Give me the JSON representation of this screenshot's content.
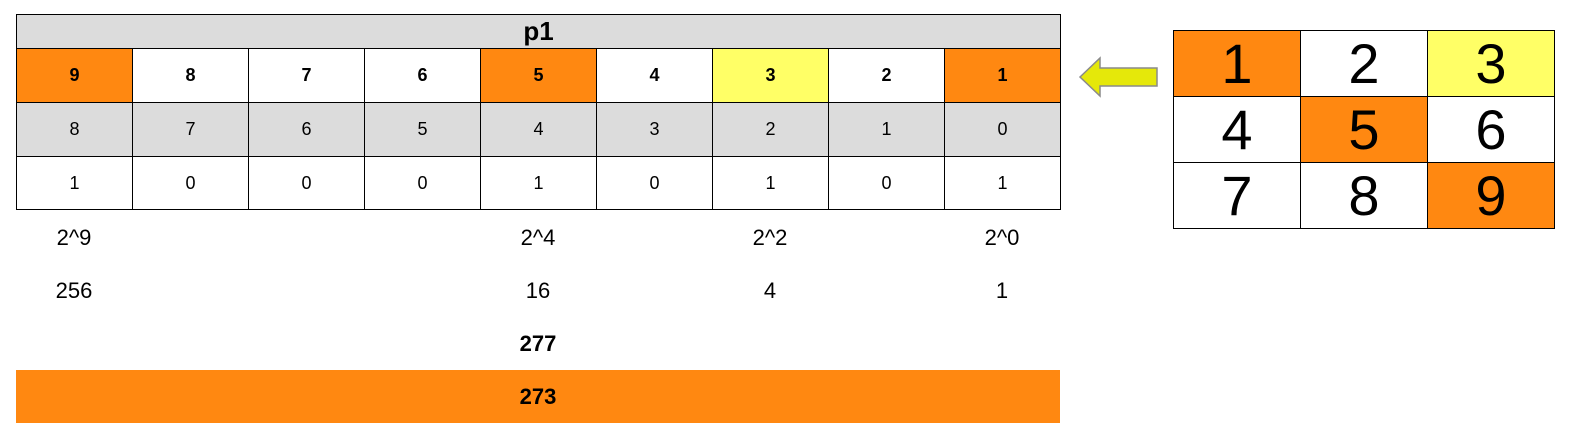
{
  "colors": {
    "orange": "#ff8811",
    "yellow": "#ffff66",
    "gray": "#dcdcdc",
    "white": "#ffffff",
    "arrow": "#e5e80a"
  },
  "table": {
    "title": "p1",
    "columns": [
      {
        "position": "9",
        "index": "8",
        "bit": "1",
        "highlight": "orange"
      },
      {
        "position": "8",
        "index": "7",
        "bit": "0",
        "highlight": "white"
      },
      {
        "position": "7",
        "index": "6",
        "bit": "0",
        "highlight": "white"
      },
      {
        "position": "6",
        "index": "5",
        "bit": "0",
        "highlight": "white"
      },
      {
        "position": "5",
        "index": "4",
        "bit": "1",
        "highlight": "orange"
      },
      {
        "position": "4",
        "index": "3",
        "bit": "0",
        "highlight": "white"
      },
      {
        "position": "3",
        "index": "2",
        "bit": "1",
        "highlight": "yellow"
      },
      {
        "position": "2",
        "index": "1",
        "bit": "0",
        "highlight": "white"
      },
      {
        "position": "1",
        "index": "0",
        "bit": "1",
        "highlight": "orange"
      }
    ]
  },
  "powers": [
    {
      "col": 0,
      "label": "2^9",
      "value": "256"
    },
    {
      "col": 4,
      "label": "2^4",
      "value": "16"
    },
    {
      "col": 6,
      "label": "2^2",
      "value": "4"
    },
    {
      "col": 8,
      "label": "2^0",
      "value": "1"
    }
  ],
  "sum": "277",
  "result": "273",
  "grid": [
    [
      {
        "value": "1",
        "highlight": "orange"
      },
      {
        "value": "2",
        "highlight": "white"
      },
      {
        "value": "3",
        "highlight": "yellow"
      }
    ],
    [
      {
        "value": "4",
        "highlight": "white"
      },
      {
        "value": "5",
        "highlight": "orange"
      },
      {
        "value": "6",
        "highlight": "white"
      }
    ],
    [
      {
        "value": "7",
        "highlight": "white"
      },
      {
        "value": "8",
        "highlight": "white"
      },
      {
        "value": "9",
        "highlight": "orange"
      }
    ]
  ]
}
